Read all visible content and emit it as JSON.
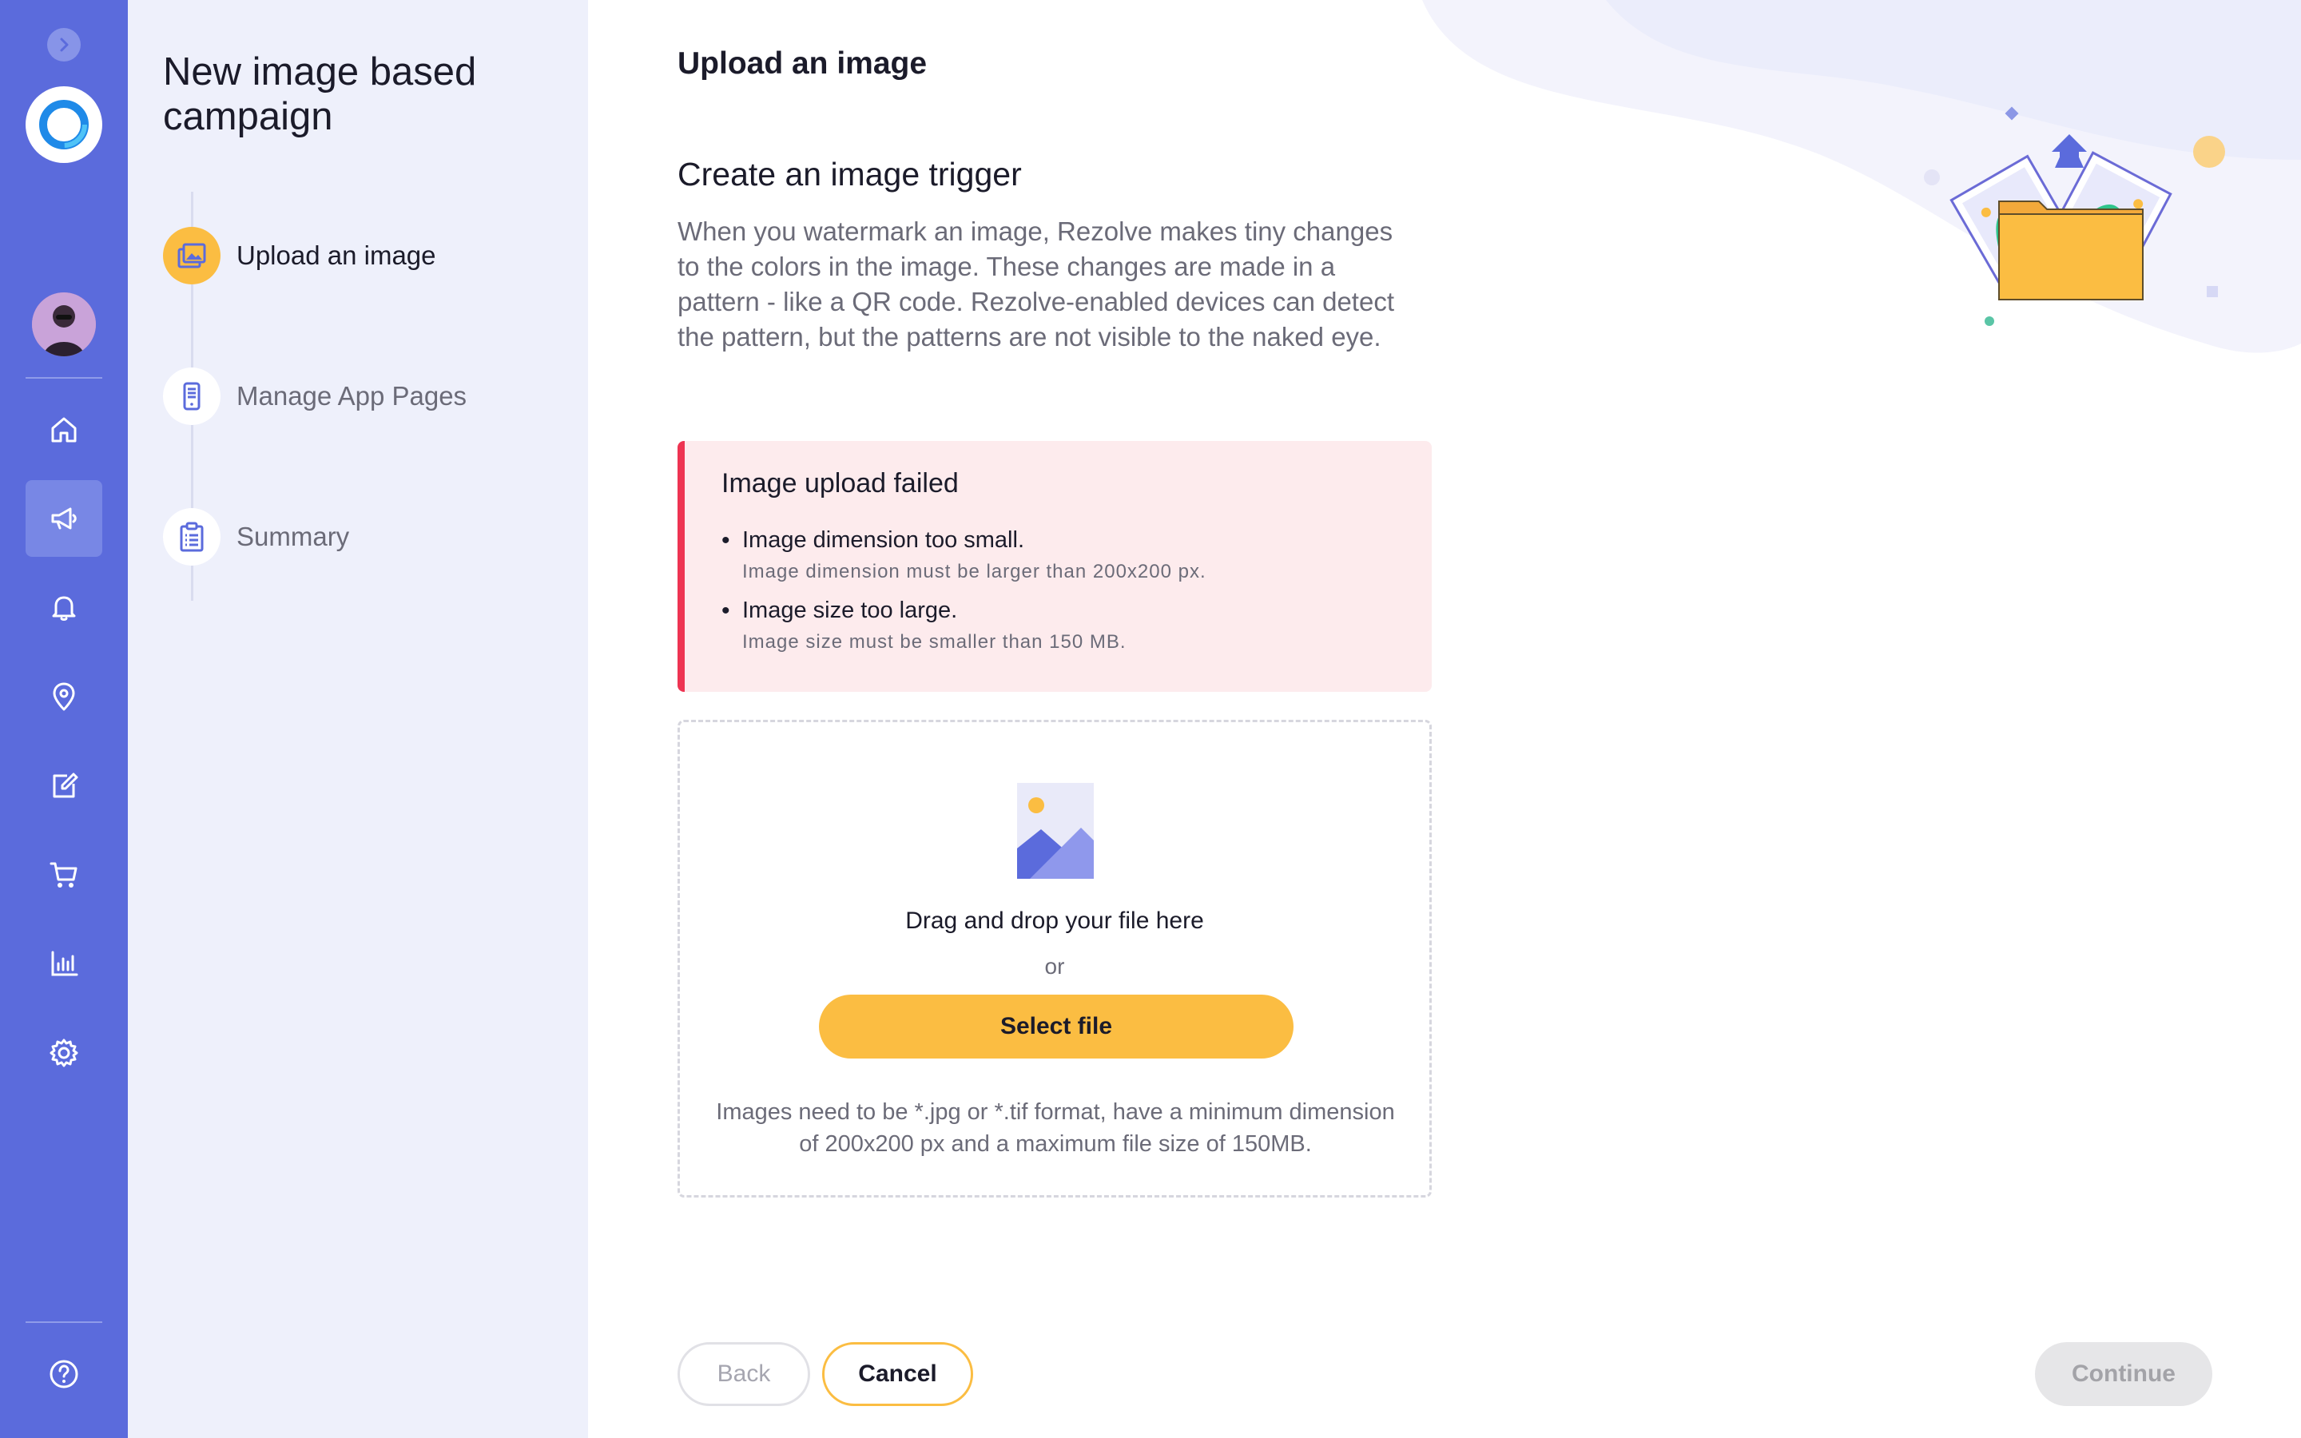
{
  "sidebar": {
    "nav": [
      {
        "icon": "home-icon"
      },
      {
        "icon": "megaphone-icon",
        "active": true
      },
      {
        "icon": "bell-icon"
      },
      {
        "icon": "location-pin-icon"
      },
      {
        "icon": "edit-icon"
      },
      {
        "icon": "cart-icon"
      },
      {
        "icon": "bar-chart-icon"
      },
      {
        "icon": "gear-icon"
      }
    ],
    "help_icon": "help-icon"
  },
  "steps_panel": {
    "title": "New image based campaign",
    "steps": [
      {
        "label": "Upload an image",
        "icon": "images-icon",
        "active": true
      },
      {
        "label": "Manage App Pages",
        "icon": "phone-icon",
        "active": false
      },
      {
        "label": "Summary",
        "icon": "clipboard-icon",
        "active": false
      }
    ]
  },
  "main": {
    "title": "Upload an image",
    "section_title": "Create an image trigger",
    "description": "When you watermark  an image, Rezolve makes tiny changes to the colors in the image. These changes are made in a pattern - like a QR code. Rezolve-enabled devices can detect the pattern, but the patterns are not visible to the naked eye.",
    "error": {
      "title": "Image upload failed",
      "items": [
        {
          "main": "Image dimension too small.",
          "detail": "Image dimension must be larger than 200x200 px."
        },
        {
          "main": "Image size too large.",
          "detail": "Image size must be smaller than 150 MB."
        }
      ]
    },
    "dropzone": {
      "drag_text": "Drag and drop your file here",
      "or_text": "or",
      "select_label": "Select file",
      "hint": "Images need to be *.jpg or *.tif format, have a minimum dimension of 200x200 px and a maximum file size of 150MB."
    }
  },
  "footer": {
    "back_label": "Back",
    "cancel_label": "Cancel",
    "continue_label": "Continue"
  },
  "colors": {
    "rail": "#5b6bdc",
    "accent": "#fbbd42",
    "error": "#ee3452",
    "panel": "#eef0fb"
  }
}
